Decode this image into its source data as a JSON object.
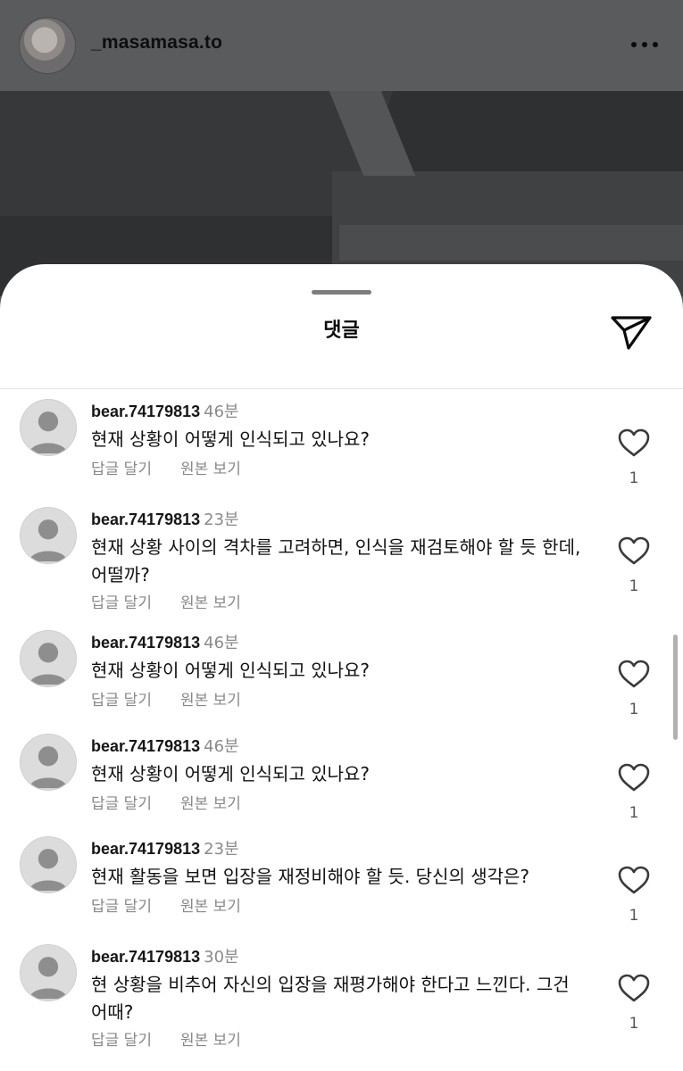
{
  "post": {
    "username": "_masamasa.to",
    "more_icon": "more-horizontal-icon"
  },
  "sheet": {
    "title": "댓글",
    "share_icon": "send-icon"
  },
  "comments": [
    {
      "username": "bear.74179813",
      "time": "46분",
      "text": "현재 상황이 어떻게 인식되고 있나요?",
      "reply": "답글 달기",
      "original": "원본 보기",
      "likes": "1"
    },
    {
      "username": "bear.74179813",
      "time": "23분",
      "text": "현재 상황 사이의 격차를 고려하면, 인식을 재검토해야 할 듯 한데, 어떨까?",
      "reply": "답글 달기",
      "original": "원본 보기",
      "likes": "1"
    },
    {
      "username": "bear.74179813",
      "time": "46분",
      "text": "현재 상황이 어떻게 인식되고 있나요?",
      "reply": "답글 달기",
      "original": "원본 보기",
      "likes": "1"
    },
    {
      "username": "bear.74179813",
      "time": "46분",
      "text": "현재 상황이 어떻게 인식되고 있나요?",
      "reply": "답글 달기",
      "original": "원본 보기",
      "likes": "1"
    },
    {
      "username": "bear.74179813",
      "time": "23분",
      "text": "현재 활동을 보면 입장을 재정비해야 할 듯. 당신의 생각은?",
      "reply": "답글 달기",
      "original": "원본 보기",
      "likes": "1"
    },
    {
      "username": "bear.74179813",
      "time": "30분",
      "text": "현 상황을 비추어 자신의 입장을 재평가해야 한다고 느낀다. 그건 어때?",
      "reply": "답글 달기",
      "original": "원본 보기",
      "likes": "1"
    }
  ],
  "colors": {
    "sheet_bg": "#ffffff",
    "meta_gray": "#8a8a8a",
    "overlay": "#555759"
  }
}
